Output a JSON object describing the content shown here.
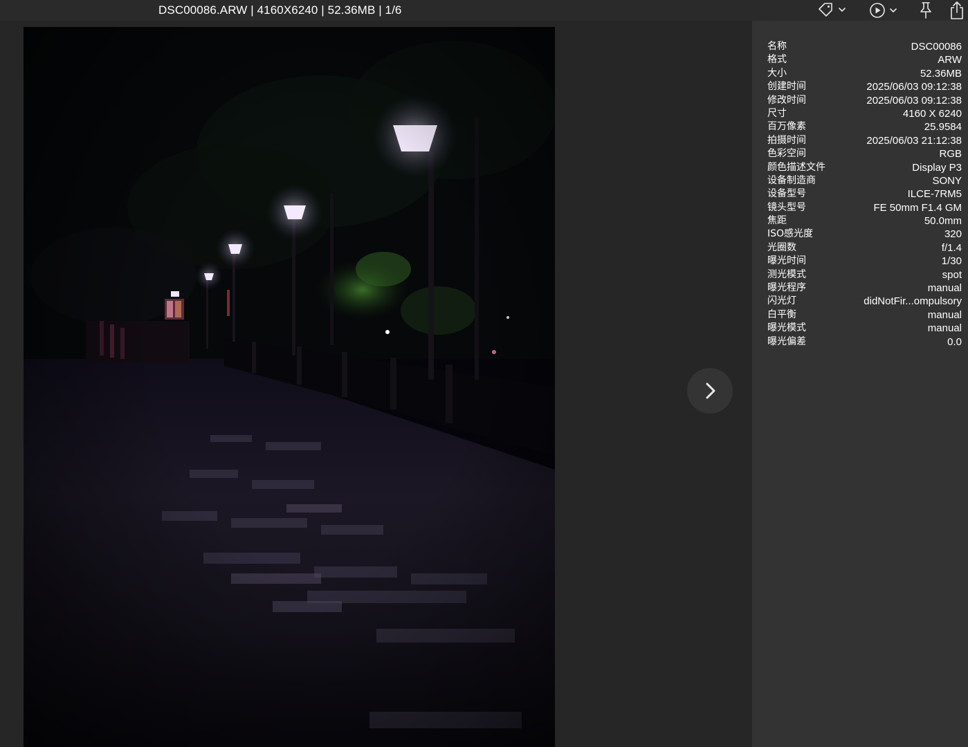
{
  "window": {
    "title": "DSC00086.ARW | 4160X6240 | 52.36MB | 1/6"
  },
  "toolbar": {
    "tag_icon": "tag-icon",
    "play_icon": "play-icon",
    "pin_icon": "pin-icon",
    "share_icon": "share-icon"
  },
  "viewer": {
    "next_icon": "chevron-right-icon"
  },
  "info": {
    "rows": [
      {
        "label": "名称",
        "value": "DSC00086"
      },
      {
        "label": "格式",
        "value": "ARW"
      },
      {
        "label": "大小",
        "value": "52.36MB"
      },
      {
        "label": "创建时间",
        "value": "2025/06/03 09:12:38"
      },
      {
        "label": "修改时间",
        "value": "2025/06/03 09:12:38"
      },
      {
        "label": "尺寸",
        "value": "4160 X 6240"
      },
      {
        "label": "百万像素",
        "value": "25.9584"
      },
      {
        "label": "拍摄时间",
        "value": "2025/06/03 21:12:38"
      },
      {
        "label": "色彩空间",
        "value": "RGB"
      },
      {
        "label": "颜色描述文件",
        "value": "Display P3"
      },
      {
        "label": "设备制造商",
        "value": "SONY"
      },
      {
        "label": "设备型号",
        "value": "ILCE-7RM5"
      },
      {
        "label": "镜头型号",
        "value": "FE 50mm F1.4 GM"
      },
      {
        "label": "焦距",
        "value": "50.0mm"
      },
      {
        "label": "ISO感光度",
        "value": "320"
      },
      {
        "label": "光圈数",
        "value": "f/1.4"
      },
      {
        "label": "曝光时间",
        "value": "1/30"
      },
      {
        "label": "测光模式",
        "value": "spot"
      },
      {
        "label": "曝光程序",
        "value": "manual"
      },
      {
        "label": "闪光灯",
        "value": "didNotFir...ompulsory"
      },
      {
        "label": "白平衡",
        "value": "manual"
      },
      {
        "label": "曝光模式",
        "value": "manual"
      },
      {
        "label": "曝光偏差",
        "value": "0.0"
      }
    ]
  }
}
